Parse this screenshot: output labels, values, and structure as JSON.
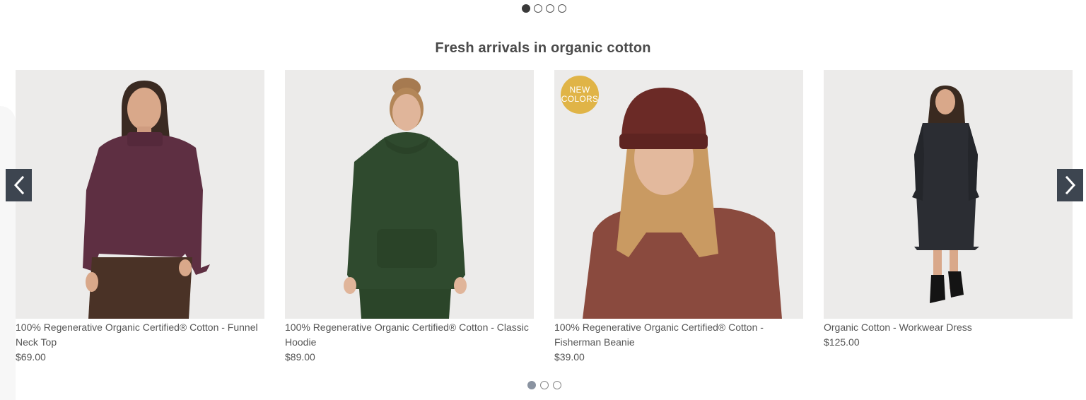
{
  "carousel_top": {
    "page_count": 4,
    "active_index": 0
  },
  "section": {
    "title": "Fresh arrivals in organic cotton"
  },
  "products": [
    {
      "name": "100% Regenerative Organic Certified® Cotton - Funnel Neck Top",
      "price": "$69.00",
      "badge": "",
      "image": "woman-in-plum-funnel-neck-top"
    },
    {
      "name": "100% Regenerative Organic Certified® Cotton - Classic Hoodie",
      "price": "$89.00",
      "badge": "",
      "image": "woman-in-green-hoodie"
    },
    {
      "name": "100% Regenerative Organic Certified® Cotton - Fisherman Beanie",
      "price": "$39.00",
      "badge": "NEW COLORS",
      "image": "woman-in-rust-beanie"
    },
    {
      "name": "Organic Cotton - Workwear Dress",
      "price": "$125.00",
      "badge": "",
      "image": "woman-in-charcoal-dress"
    }
  ],
  "carousel_bottom": {
    "page_count": 3,
    "active_index": 0
  },
  "icons": {
    "prev": "chevron-left-icon",
    "next": "chevron-right-icon"
  },
  "colors": {
    "arrow_bg": "#3d4550",
    "badge": "#e0b447",
    "photo_bg": "#ecebea"
  }
}
